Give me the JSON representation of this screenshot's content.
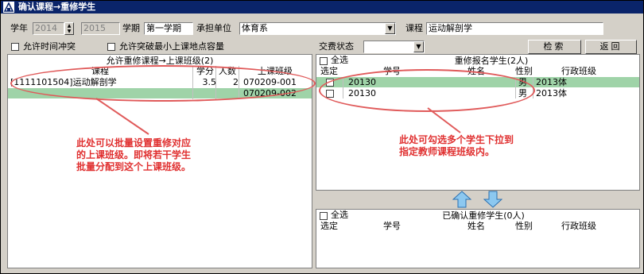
{
  "window": {
    "title": "确认课程→重修学生"
  },
  "toolbar": {
    "year_label": "学年",
    "year_from": "2014",
    "year_to": "2015",
    "term_label": "学期",
    "term_value": "第一学期",
    "dept_label": "承担单位",
    "dept_value": "体育系",
    "course_label": "课程",
    "course_value": "运动解剖学",
    "allow_time_conflict": "允许时间冲突",
    "allow_capacity": "允许突破最小上课地点容量",
    "fee_status_label": "交费状态",
    "fee_status_value": "",
    "search_button": "检索",
    "back_button": "返回"
  },
  "left_panel": {
    "title": "允许重修课程→上课班级(2)",
    "columns": [
      "课程",
      "学分",
      "人数",
      "上课班级"
    ],
    "rows": [
      {
        "course": "[1111101504]运动解剖学",
        "credit": "3.5",
        "count": "2",
        "class": "070209-001"
      },
      {
        "course": "",
        "credit": "",
        "count": "",
        "class": "070209-002"
      }
    ]
  },
  "right_top_panel": {
    "select_all": "全选",
    "title": "重修报名学生(2人)",
    "columns": [
      "选定",
      "学号",
      "姓名",
      "性别",
      "行政班级"
    ],
    "rows": [
      {
        "id": "20130",
        "name": "",
        "gender": "男",
        "admin_class": "2013体"
      },
      {
        "id": "20130",
        "name": "",
        "gender": "男",
        "admin_class": "2013体"
      }
    ]
  },
  "right_bottom_panel": {
    "select_all": "全选",
    "title": "已确认重修学生(0人)",
    "columns": [
      "选定",
      "学号",
      "姓名",
      "性别",
      "行政班级"
    ]
  },
  "annotations": {
    "left_line1": "此处可以批量设置重修对应",
    "left_line2": "的上课班级。即将若干学生",
    "left_line3": "批量分配到这个上课班级。",
    "right_line1": "此处可勾选多个学生下拉到",
    "right_line2": "指定教师课程班级内。"
  },
  "colors": {
    "highlight_row": "#9fd3a8",
    "annotation": "#e03030",
    "arrow": "#8cc8f0"
  }
}
